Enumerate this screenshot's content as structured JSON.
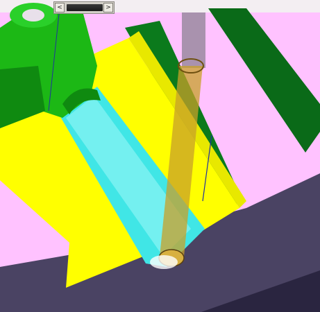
{
  "window": {
    "title": ""
  },
  "scrollbar": {
    "left_icon": "chevron-left-icon",
    "right_icon": "chevron-right-icon",
    "left_glyph": "<",
    "right_glyph": ">",
    "position_fraction": 0.05
  },
  "viewport": {
    "scene": "3d-cad-model",
    "colors": {
      "background": "#4a4363",
      "part_top": "#ffc2ff",
      "slot_floor": "#ffff00",
      "boss": "#1cb815",
      "wall_stripe": "#0a6a18",
      "channel": "#40e6e6",
      "tool_shaft": "#c8a028"
    }
  }
}
